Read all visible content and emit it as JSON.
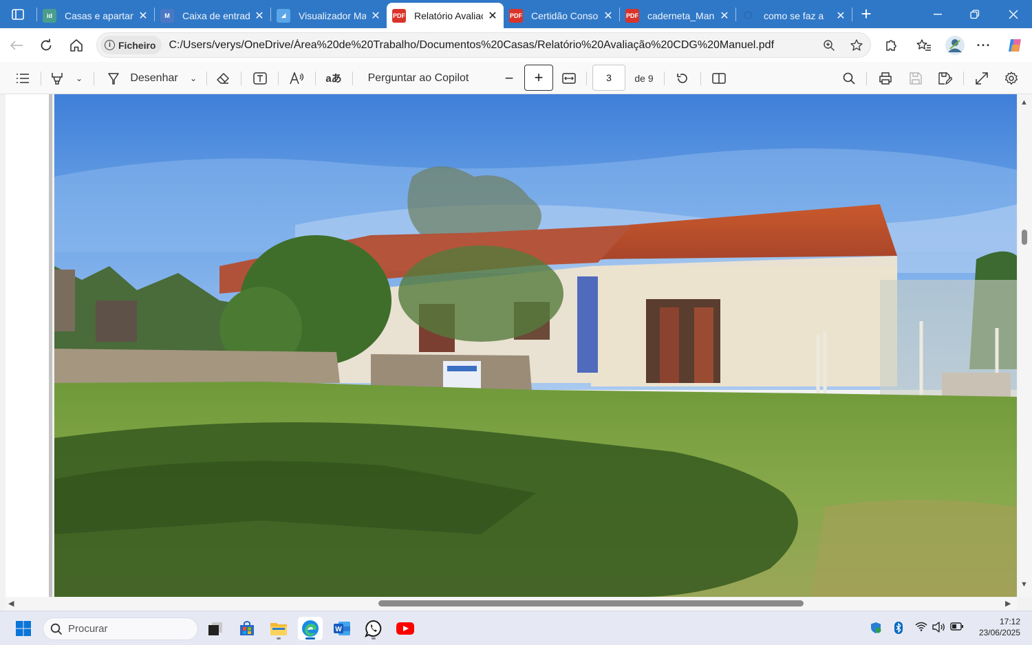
{
  "browser": {
    "tabs": [
      {
        "title": "Casas e apartamentos",
        "favicon": "idealista-icon",
        "favicon_color": "#4a9e8e",
        "active": false
      },
      {
        "title": "Caixa de entrada",
        "favicon": "gmail-icon",
        "favicon_color": "#4a78c4",
        "active": false
      },
      {
        "title": "Visualizador Mapas",
        "favicon": "map-icon",
        "favicon_color": "#5aa6e8",
        "active": false
      },
      {
        "title": "Relatório Avaliação",
        "favicon": "pdf-icon",
        "favicon_color": "#d9342b",
        "active": true
      },
      {
        "title": "Certidão Consolidada",
        "favicon": "pdf-icon",
        "favicon_color": "#d9342b",
        "active": false
      },
      {
        "title": "caderneta_Manuel",
        "favicon": "pdf-icon",
        "favicon_color": "#d9342b",
        "active": false
      },
      {
        "title": "como se faz a",
        "favicon": "search-icon",
        "favicon_color": "#2f78c7",
        "active": false
      }
    ],
    "new_tab_label": "+",
    "address": {
      "chip_label": "Ficheiro",
      "url": "C:/Users/verys/OneDrive/Área%20de%20Trabalho/Documentos%20Casas/Relatório%20Avaliação%20CDG%20Manuel.pdf"
    }
  },
  "pdf_toolbar": {
    "draw_label": "Desenhar",
    "copilot_label": "Perguntar ao Copilot",
    "page_current": "3",
    "page_total_label": "de 9"
  },
  "viewer": {
    "image_description": "house-photo"
  },
  "taskbar": {
    "search_placeholder": "Procurar",
    "time": "17:12",
    "date": "23/06/2025"
  },
  "colors": {
    "tabbar": "#2f78c7",
    "accent": "#0067c0"
  }
}
